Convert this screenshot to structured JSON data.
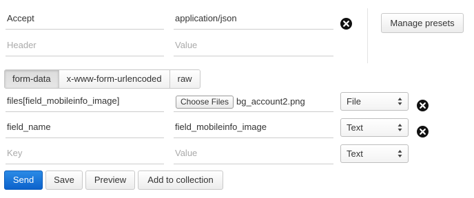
{
  "headers": {
    "rows": [
      {
        "key": "Accept",
        "value": "application/json"
      }
    ],
    "placeholder_key": "Header",
    "placeholder_value": "Value"
  },
  "manage_presets_label": "Manage presets",
  "body_tabs": [
    "form-data",
    "x-www-form-urlencoded",
    "raw"
  ],
  "active_body_tab": "form-data",
  "form_rows": [
    {
      "key": "files[field_mobileinfo_image]",
      "choose_files_label": "Choose Files",
      "file_name": "bg_account2.png",
      "type": "File"
    },
    {
      "key": "field_name",
      "value": "field_mobileinfo_image",
      "type": "Text"
    }
  ],
  "form_placeholder": {
    "key": "Key",
    "value": "Value",
    "type": "Text"
  },
  "actions": {
    "send": "Send",
    "save": "Save",
    "preview": "Preview",
    "add_to_collection": "Add to collection"
  },
  "colors": {
    "send_button": "#0c62cc",
    "close_icon": "#111111"
  },
  "icons": [
    "close-icon",
    "select-arrows-icon"
  ]
}
